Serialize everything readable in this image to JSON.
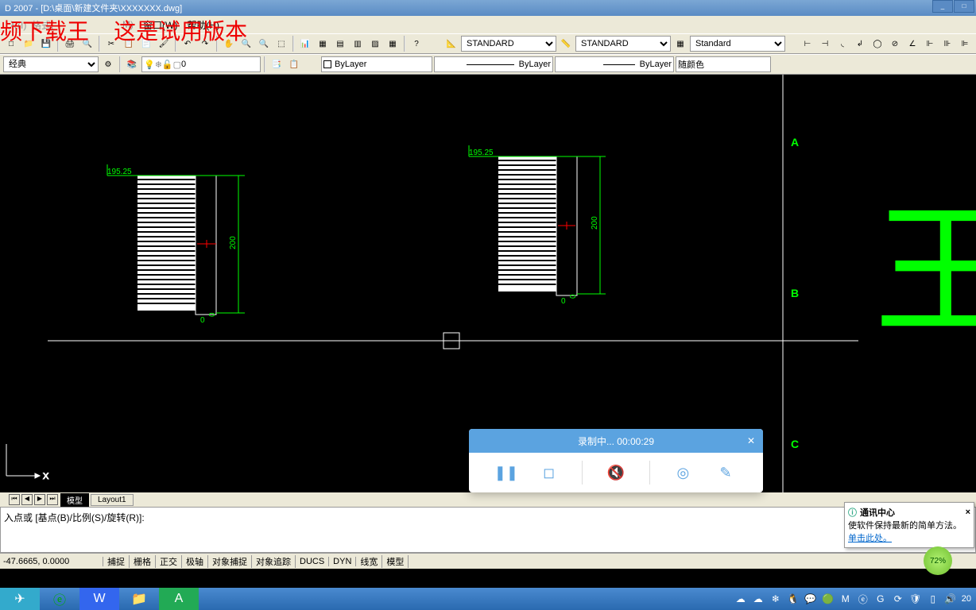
{
  "title_bar": {
    "text": "D 2007 - [D:\\桌面\\新建文件夹\\XXXXXXX.dwg]"
  },
  "overlay": {
    "left": "频下载王",
    "right": "这是试用版本"
  },
  "menu": {
    "window": "窗口(W)",
    "help": "帮助(H)"
  },
  "toolbar1": {
    "style1": "STANDARD",
    "style2": "STANDARD",
    "style3": "Standard"
  },
  "toolbar2": {
    "mode": "经典",
    "layer": "0",
    "color": "ByLayer",
    "linetype": "ByLayer",
    "lineweight": "ByLayer",
    "plotcolor": "随颜色"
  },
  "drawing": {
    "dim_left": "195.25",
    "dim_right": "195.25",
    "height_left": "200",
    "height_right": "200",
    "axis_x": "X",
    "marker_a": "A",
    "marker_b": "B",
    "marker_c": "C",
    "zero": "0",
    "cjk_char": "王"
  },
  "layout": {
    "model": "模型",
    "layout1": "Layout1"
  },
  "command": {
    "prompt": "入点或 [基点(B)/比例(S)/旋转(R)]:"
  },
  "status": {
    "coords": "-47.6665, 0.0000",
    "snap": "捕捉",
    "grid": "栅格",
    "ortho": "正交",
    "polar": "极轴",
    "osnap": "对象捕捉",
    "otrack": "对象追踪",
    "ducs": "DUCS",
    "dyn": "DYN",
    "lwt": "线宽",
    "model": "模型"
  },
  "notif": {
    "title": "通讯中心",
    "body": "使软件保持最新的简单方法。",
    "link": "单击此处。"
  },
  "progress": {
    "pct": "72%"
  },
  "recorder": {
    "header": "录制中... 00:00:29"
  },
  "taskbar": {
    "time": "20"
  }
}
